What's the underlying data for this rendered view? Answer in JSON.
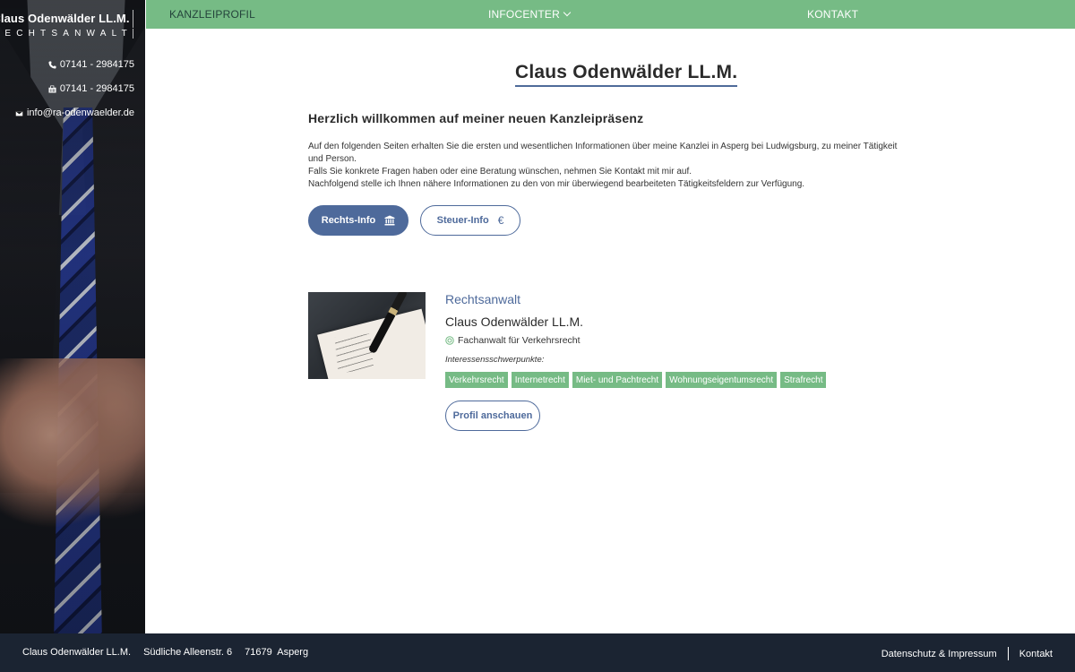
{
  "sidebar": {
    "brand_name": "Claus Odenwälder LL.M.",
    "brand_sub": "RECHTSANWALT",
    "phone": "07141 - 2984175",
    "fax": "07141 - 2984175",
    "email": "info@ra-odenwaelder.de"
  },
  "nav": {
    "items": [
      {
        "label": "KANZLEIPROFIL"
      },
      {
        "label": "INFOCENTER"
      },
      {
        "label": "KONTAKT"
      }
    ]
  },
  "main": {
    "title": "Claus Odenwälder LL.M.",
    "welcome": "Herzlich willkommen auf meiner neuen Kanzleipräsenz",
    "intro": [
      "Auf den folgenden Seiten erhalten Sie die ersten und wesentlichen Informationen über meine Kanzlei in Asperg bei Ludwigsburg, zu meiner Tätigkeit und Person.",
      "Falls Sie konkrete Fragen haben oder eine Beratung wünschen, nehmen Sie Kontakt mit mir auf.",
      "Nachfolgend stelle ich Ihnen nähere Informationen zu den von mir überwiegend bearbeiteten Tätigkeitsfeldern zur Verfügung."
    ],
    "buttons": {
      "rechts": "Rechts-Info",
      "steuer": "Steuer-Info",
      "steuer_symbol": "€"
    }
  },
  "profile": {
    "role": "Rechtsanwalt",
    "name": "Claus Odenwälder LL.M.",
    "specialty": "Fachanwalt für Verkehrsrecht",
    "interests_label": "Interessensschwerpunkte:",
    "tags": [
      "Verkehrsrecht",
      "Internetrecht",
      "Miet- und Pachtrecht",
      "Wohnungseigentumsrecht",
      "Strafrecht"
    ],
    "button": "Profil anschauen"
  },
  "footer": {
    "name": "Claus Odenwälder LL.M.",
    "street": "Südliche Alleenstr. 6",
    "city": "71679  Asperg",
    "links": [
      "Datenschutz & Impressum",
      "Kontakt"
    ]
  },
  "colors": {
    "nav_green": "#76bb85",
    "accent_blue": "#4e6a9b",
    "footer_navy": "#1b2432"
  },
  "icons": [
    "phone-icon",
    "fax-icon",
    "mail-icon",
    "chevron-down-icon",
    "bank-icon",
    "award-icon"
  ]
}
